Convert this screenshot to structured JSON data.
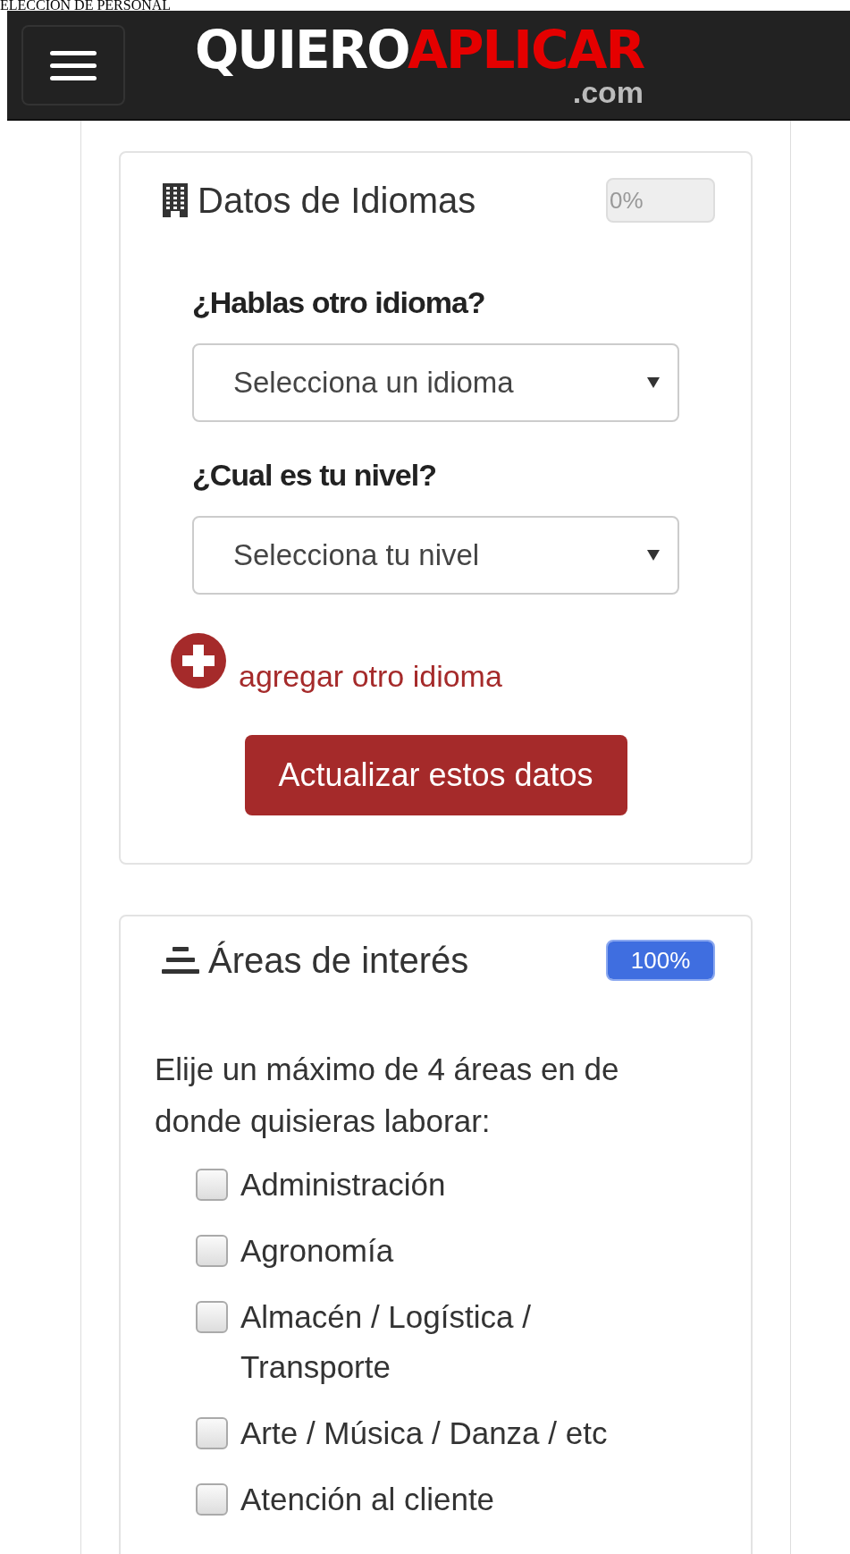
{
  "page_title": "ELECCION DE PERSONAL",
  "header": {
    "logo_main": "QUIERO",
    "logo_accent": "APLICAR",
    "logo_suffix": ".com"
  },
  "language_card": {
    "title": "Datos de Idiomas",
    "progress": {
      "level": 0,
      "reading": "0%"
    },
    "fields": [
      {
        "label": "¿Hablas otro idioma?",
        "placeholder": "Selecciona un idioma"
      },
      {
        "label": "¿Cual es tu nivel?",
        "placeholder": "Selecciona tu nivel"
      }
    ],
    "add_link": "agregar otro idioma",
    "submit": "Actualizar estos datos"
  },
  "areas_card": {
    "title": "Áreas de interés",
    "progress": {
      "level": 1,
      "reading": "100%"
    },
    "instructions": "Elije un máximo de 4 áreas en de donde quisieras laborar:",
    "options": [
      {
        "label": "Administración",
        "checked": false
      },
      {
        "label": "Agronomía",
        "checked": false
      },
      {
        "label": "Almacén / Logística / Transporte",
        "checked": false
      },
      {
        "label": "Arte / Música / Danza / etc",
        "checked": false
      },
      {
        "label": "Atención al cliente",
        "checked": false
      }
    ]
  }
}
